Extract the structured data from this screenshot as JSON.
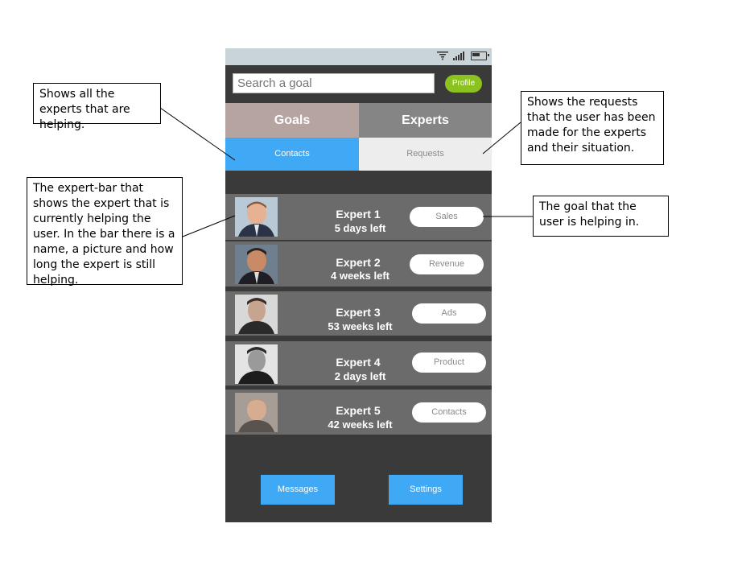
{
  "statusbar": {
    "icons": [
      "wifi-icon",
      "signal-icon",
      "battery-icon"
    ]
  },
  "header": {
    "search_placeholder": "Search a goal",
    "profile_label": "Profile"
  },
  "tabs": {
    "goals": "Goals",
    "experts": "Experts"
  },
  "subtabs": {
    "contacts": "Contacts",
    "requests": "Requests"
  },
  "experts": [
    {
      "name": "Expert 1",
      "time_left": "5 days left",
      "goal": "Sales"
    },
    {
      "name": "Expert 2",
      "time_left": "4 weeks left",
      "goal": "Revenue"
    },
    {
      "name": "Expert 3",
      "time_left": "53 weeks left",
      "goal": "Ads"
    },
    {
      "name": "Expert 4",
      "time_left": "2 days left",
      "goal": "Product"
    },
    {
      "name": "Expert 5",
      "time_left": "42 weeks left",
      "goal": "Contacts"
    }
  ],
  "footer": {
    "messages": "Messages",
    "settings": "Settings"
  },
  "annotations": {
    "experts_note": "Shows all the experts that are helping.",
    "requests_note": "Shows the requests that the user has been made for the experts and their situation.",
    "expertbar_note": "The expert-bar that shows the expert that is currently helping the user. In the bar there is a name, a picture and how long the expert is still helping.",
    "goal_note": "The goal that the user is helping in."
  },
  "colors": {
    "accent_blue": "#3fa9f5",
    "profile_green": "#8cc21f",
    "goals_tab": "#b6a4a0",
    "experts_tab": "#858585",
    "row_bg": "#6b6b6b",
    "phone_bg": "#3a3a3a"
  }
}
